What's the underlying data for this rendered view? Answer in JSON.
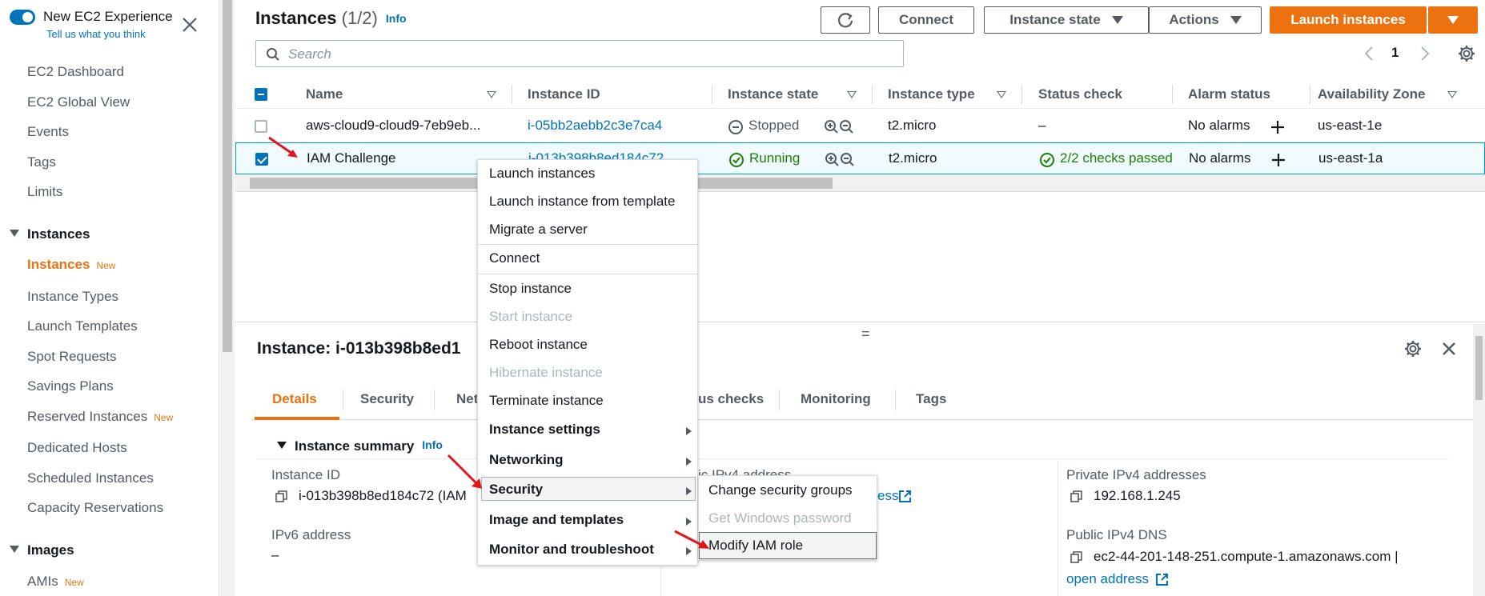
{
  "sidebar": {
    "new_experience_label": "New EC2 Experience",
    "tell_us": "Tell us what you think",
    "items": [
      {
        "label": "EC2 Dashboard"
      },
      {
        "label": "EC2 Global View"
      },
      {
        "label": "Events"
      },
      {
        "label": "Tags"
      },
      {
        "label": "Limits"
      }
    ],
    "instances_section": "Instances",
    "instances_items": [
      {
        "label": "Instances",
        "badge": "New"
      },
      {
        "label": "Instance Types"
      },
      {
        "label": "Launch Templates"
      },
      {
        "label": "Spot Requests"
      },
      {
        "label": "Savings Plans"
      },
      {
        "label": "Reserved Instances",
        "badge": "New"
      },
      {
        "label": "Dedicated Hosts"
      },
      {
        "label": "Scheduled Instances"
      },
      {
        "label": "Capacity Reservations"
      }
    ],
    "images_section": "Images",
    "images_items": [
      {
        "label": "AMIs",
        "badge": "New"
      }
    ]
  },
  "header": {
    "title": "Instances",
    "count": "(1/2)",
    "info": "Info",
    "connect": "Connect",
    "instance_state": "Instance state",
    "actions": "Actions",
    "launch": "Launch instances"
  },
  "search": {
    "placeholder": "Search"
  },
  "pager": {
    "page": "1"
  },
  "table": {
    "columns": [
      "Name",
      "Instance ID",
      "Instance state",
      "Instance type",
      "Status check",
      "Alarm status",
      "Availability Zone"
    ],
    "rows": [
      {
        "name": "aws-cloud9-cloud9-7eb9eb...",
        "id": "i-05bb2aebb2c3e7ca4",
        "state": "Stopped",
        "type": "t2.micro",
        "status": "–",
        "alarm": "No alarms",
        "az": "us-east-1e"
      },
      {
        "name": "IAM Challenge",
        "id": "i-013b398b8ed184c72",
        "state": "Running",
        "type": "t2.micro",
        "status": "2/2 checks passed",
        "alarm": "No alarms",
        "az": "us-east-1a"
      }
    ]
  },
  "detail": {
    "title": "Instance: i-013b398b8ed1",
    "tabs": [
      "Details",
      "Security",
      "Net",
      "us checks",
      "Monitoring",
      "Tags"
    ],
    "summary": "Instance summary",
    "summary_info": "Info",
    "instance_id_label": "Instance ID",
    "instance_id_value": "i-013b398b8ed184c72 (IAM",
    "ipv6_label": "IPv6 address",
    "ipv6_value": "–",
    "public_ipv4_label": "ic IPv4 address",
    "public_ipv4_link": "ess",
    "private_ipv4_label": "Private IPv4 addresses",
    "private_ipv4_value": "192.168.1.245",
    "public_dns_label": "Public IPv4 DNS",
    "public_dns_value": "ec2-44-201-148-251.compute-1.amazonaws.com |",
    "open_address": "open address"
  },
  "context_menu": {
    "items": [
      {
        "label": "Launch instances"
      },
      {
        "label": "Launch instance from template"
      },
      {
        "label": "Migrate a server"
      },
      {
        "label": "Connect"
      },
      {
        "label": "Stop instance"
      },
      {
        "label": "Start instance",
        "disabled": true
      },
      {
        "label": "Reboot instance"
      },
      {
        "label": "Hibernate instance",
        "disabled": true
      },
      {
        "label": "Terminate instance"
      },
      {
        "label": "Instance settings",
        "submenu": true
      },
      {
        "label": "Networking",
        "submenu": true
      },
      {
        "label": "Security",
        "submenu": true,
        "highlighted": true
      },
      {
        "label": "Image and templates",
        "submenu": true
      },
      {
        "label": "Monitor and troubleshoot",
        "submenu": true
      }
    ],
    "security_submenu": [
      {
        "label": "Change security groups"
      },
      {
        "label": "Get Windows password",
        "disabled": true
      },
      {
        "label": "Modify IAM role",
        "highlighted": true
      }
    ]
  },
  "colors": {
    "accent": "#ec7211",
    "link": "#0073bb",
    "success": "#1d8102",
    "annotation_arrow": "#e0161d"
  }
}
